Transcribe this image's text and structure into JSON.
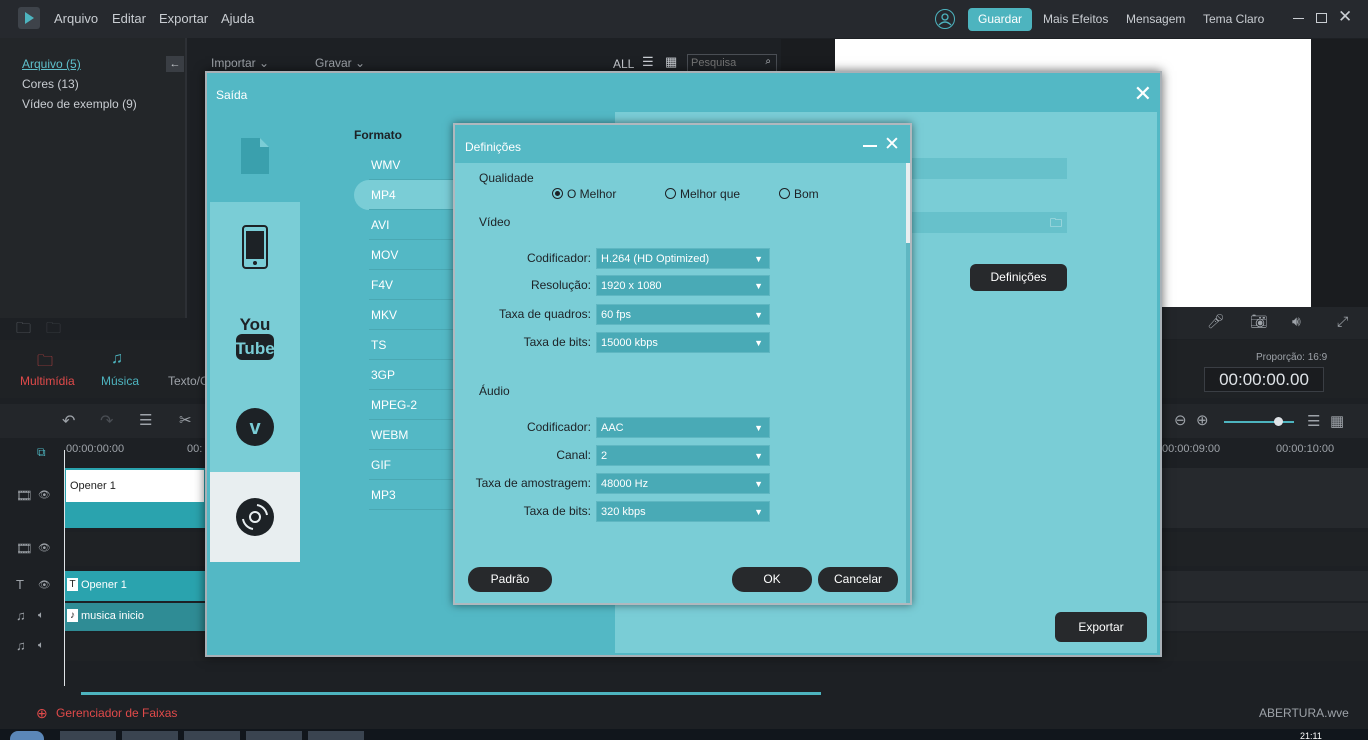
{
  "menu": [
    "Arquivo",
    "Editar",
    "Exportar",
    "Ajuda"
  ],
  "topright": {
    "save": "Guardar",
    "effects": "Mais Efeitos",
    "message": "Mensagem",
    "theme": "Tema Claro"
  },
  "library": {
    "items": [
      "Arquivo (5)",
      "Cores (13)",
      "Vídeo de exemplo (9)"
    ]
  },
  "toolbar": {
    "import": "Importar",
    "record": "Gravar",
    "all": "ALL",
    "search_placeholder": "Pesquisa"
  },
  "media_tabs": [
    "Multimídia",
    "Música",
    "Texto/C"
  ],
  "timeline": {
    "ticks": [
      "00:00:00:00",
      "00:",
      "00:00:09:00",
      "00:00:10:00"
    ],
    "clips": {
      "video": "Opener 1",
      "title": "Opener 1",
      "audio": "musica inicio"
    },
    "manager": "Gerenciador de Faixas",
    "filename": "ABERTURA.wve",
    "ratio": "Proporção: 16:9",
    "timecode": "00:00:00.00"
  },
  "saida": {
    "title": "Saída",
    "format_label": "Formato",
    "formats": [
      "WMV",
      "MP4",
      "AVI",
      "MOV",
      "F4V",
      "MKV",
      "TS",
      "3GP",
      "MPEG-2",
      "WEBM",
      "GIF",
      "MP3"
    ],
    "selected_format": "MP4",
    "settings_button": "Definições",
    "export_button": "Exportar"
  },
  "defs": {
    "title": "Definições",
    "quality_label": "Qualidade",
    "quality_options": [
      "O Melhor",
      "Melhor que",
      "Bom"
    ],
    "video_label": "Vídeo",
    "audio_label": "Áudio",
    "video": [
      {
        "label": "Codificador:",
        "value": "H.264 (HD Optimized)"
      },
      {
        "label": "Resolução:",
        "value": "1920 x 1080"
      },
      {
        "label": "Taxa de quadros:",
        "value": "60 fps"
      },
      {
        "label": "Taxa de bits:",
        "value": "15000 kbps"
      }
    ],
    "audio": [
      {
        "label": "Codificador:",
        "value": "AAC"
      },
      {
        "label": "Canal:",
        "value": "2"
      },
      {
        "label": "Taxa de amostragem:",
        "value": "48000 Hz"
      },
      {
        "label": "Taxa de bits:",
        "value": "320 kbps"
      }
    ],
    "default_button": "Padrão",
    "ok_button": "OK",
    "cancel_button": "Cancelar"
  },
  "taskbar": {
    "clock": "21:11"
  }
}
